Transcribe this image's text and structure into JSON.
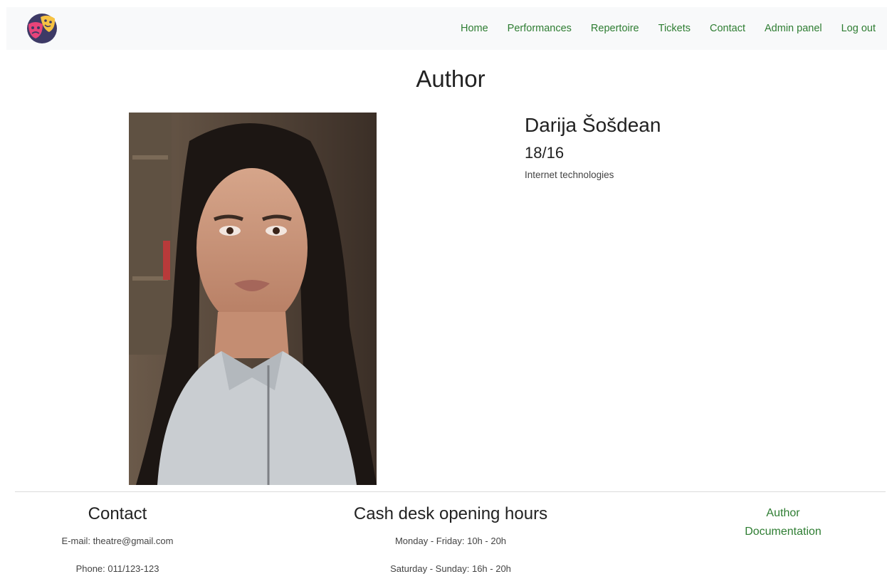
{
  "nav": {
    "links": [
      "Home",
      "Performances",
      "Repertoire",
      "Tickets",
      "Contact",
      "Admin panel",
      "Log out"
    ]
  },
  "page": {
    "title": "Author"
  },
  "author": {
    "name": "Darija Šošdean",
    "index": "18/16",
    "course": "Internet technologies"
  },
  "footer": {
    "contact": {
      "heading": "Contact",
      "email": "E-mail: theatre@gmail.com",
      "phone": "Phone: 011/123-123"
    },
    "hours": {
      "heading": "Cash desk opening hours",
      "weekdays": "Monday - Friday: 10h - 20h",
      "weekend": "Saturday - Sunday: 16h - 20h"
    },
    "links": [
      "Author",
      "Documentation"
    ]
  },
  "colors": {
    "link": "#2e7d32",
    "navbar_bg": "#f8f9fa"
  }
}
